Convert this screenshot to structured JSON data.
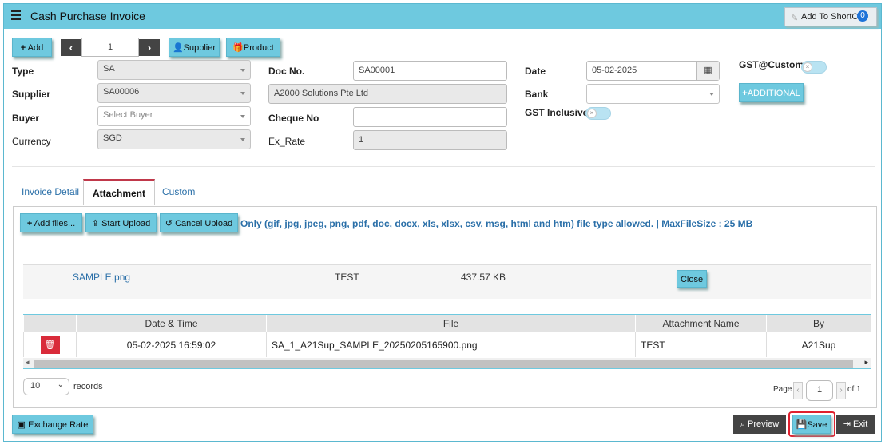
{
  "header": {
    "title": "Cash Purchase Invoice",
    "shortcut_label": "Add To ShortCut",
    "shortcut_count": "0"
  },
  "toolbar": {
    "add_label": "Add",
    "page_value": "1",
    "supplier_label": "Supplier",
    "product_label": "Product"
  },
  "form": {
    "type_label": "Type",
    "type_value": "SA",
    "supplier_label": "Supplier",
    "supplier_value": "SA00006",
    "buyer_label": "Buyer",
    "buyer_placeholder": "Select Buyer",
    "currency_label": "Currency",
    "currency_value": "SGD",
    "docno_label": "Doc No.",
    "docno_value": "SA00001",
    "supplier_name_value": "A2000 Solutions Pte Ltd",
    "cheque_label": "Cheque No",
    "cheque_value": "",
    "exrate_label": "Ex_Rate",
    "exrate_value": "1",
    "date_label": "Date",
    "date_value": "05-02-2025",
    "bank_label": "Bank",
    "bank_value": "",
    "gst_inclusive_label": "GST Inclusive",
    "gst_custom_label": "GST@Custom",
    "additional_label": "ADDITIONAL"
  },
  "tabs": [
    {
      "label": "Invoice Detail"
    },
    {
      "label": "Attachment"
    },
    {
      "label": "Custom"
    }
  ],
  "attachment": {
    "add_files_label": "Add files...",
    "start_upload_label": "Start Upload",
    "cancel_upload_label": "Cancel Upload",
    "info_text": "Only (gif, jpg, jpeg, png, pdf, doc, docx, xls, xlsx, csv, msg, html and htm) file type allowed. | MaxFileSize : 25 MB",
    "pending_file": {
      "name": "SAMPLE.png",
      "title": "TEST",
      "size": "437.57 KB",
      "close_label": "Close"
    },
    "table": {
      "headers": [
        "",
        "Date & Time",
        "File",
        "Attachment Name",
        "By"
      ],
      "rows": [
        {
          "datetime": "05-02-2025 16:59:02",
          "file": "SA_1_A21Sup_SAMPLE_20250205165900.png",
          "attachment_name": "TEST",
          "by": "A21Sup"
        }
      ]
    },
    "page_size": "10",
    "records_label": "records",
    "page_label": "Page",
    "page_value": "1",
    "of_label": "of 1"
  },
  "footer": {
    "exchange_rate_label": "Exchange Rate",
    "preview_label": "Preview",
    "save_label": "Save",
    "exit_label": "Exit"
  },
  "colors": {
    "accent": "#6ec9df",
    "dark_button": "#444444",
    "delete_red": "#d92b3a",
    "save_highlight": "#e0202e"
  }
}
